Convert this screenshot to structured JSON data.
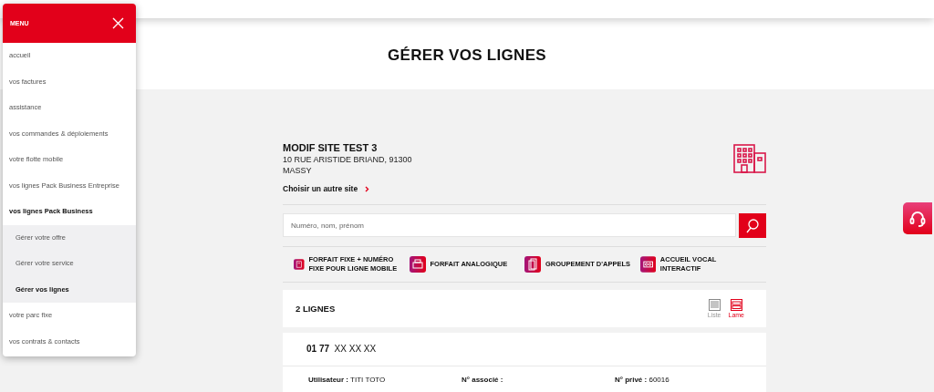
{
  "menu": {
    "title": "MENU",
    "items": [
      {
        "label": "accueil",
        "selected": false
      },
      {
        "label": "vos factures",
        "selected": false
      },
      {
        "label": "assistance",
        "selected": false
      },
      {
        "label": "vos commandes & déploiements",
        "selected": false
      },
      {
        "label": "votre flotte mobile",
        "selected": false
      },
      {
        "label": "vos lignes Pack Business Entreprise",
        "selected": false
      },
      {
        "label": "vos lignes Pack Business",
        "selected": true,
        "expanded": true,
        "children": [
          {
            "label": "Gérer votre offre",
            "selected": false
          },
          {
            "label": "Gérer votre service",
            "selected": false
          },
          {
            "label": "Gérer vos lignes",
            "selected": true
          }
        ]
      },
      {
        "label": "votre parc fixe",
        "selected": false
      },
      {
        "label": "vos contrats & contacts",
        "selected": false
      }
    ]
  },
  "page_title": "GÉRER VOS LIGNES",
  "site": {
    "name": "MODIF SITE TEST 3",
    "address_lines": [
      "10 RUE ARISTIDE BRIAND, 91300",
      "MASSY"
    ],
    "change_link": "Choisir un autre site"
  },
  "search": {
    "placeholder": "Numéro, nom, prénom"
  },
  "offers": [
    {
      "kind": "phone",
      "label": "FORFAIT FIXE + NUMÉRO FIXE POUR LIGNE MOBILE"
    },
    {
      "kind": "fax",
      "label": "FORFAIT ANALOGIQUE"
    },
    {
      "kind": "group",
      "label": "GROUPEMENT D'APPELS"
    },
    {
      "kind": "voicemail",
      "label": "ACCUEIL VOCAL INTERACTIF"
    }
  ],
  "lines_header": {
    "count": "2 LIGNES",
    "views": [
      {
        "label": "Liste",
        "selected": false
      },
      {
        "label": "Lame",
        "selected": true
      }
    ]
  },
  "line": {
    "number_prefix": "01 77",
    "number_rest": "XX XX XX",
    "fields": [
      {
        "label": "Utilisateur :",
        "value": "TITI TOTO"
      },
      {
        "label": "N° associé :"
      },
      {
        "label": "N° privé :",
        "value": "60016"
      }
    ]
  }
}
